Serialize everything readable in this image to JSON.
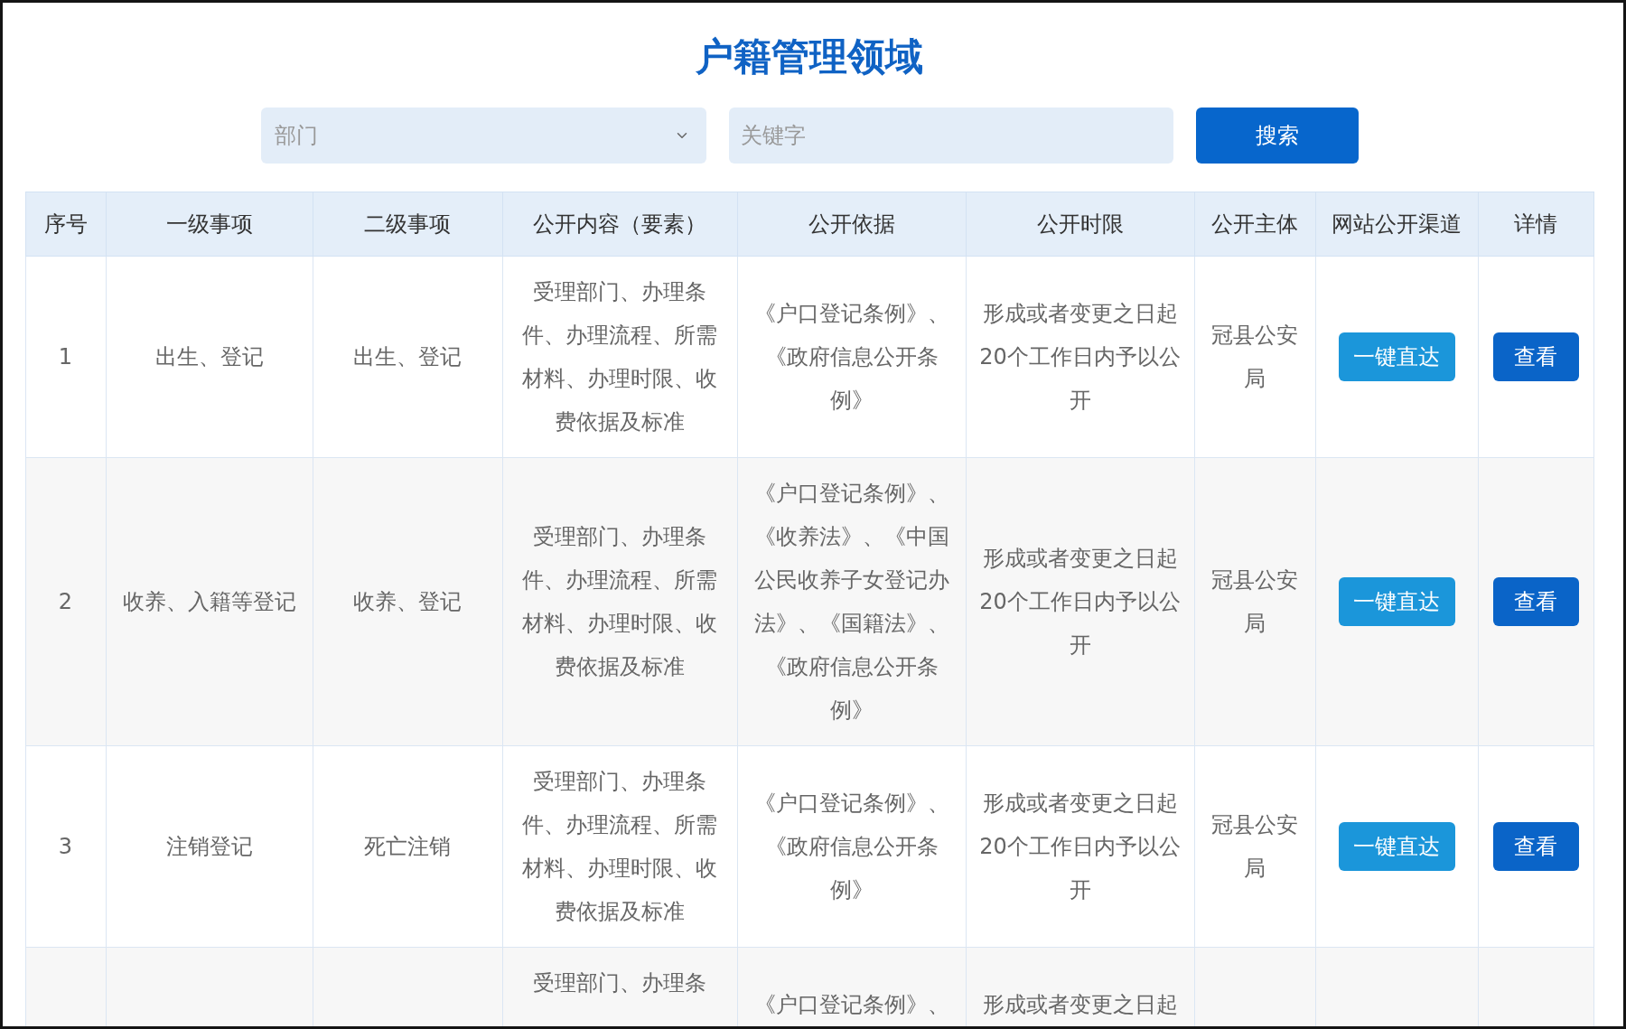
{
  "title": "户籍管理领域",
  "filters": {
    "department": {
      "placeholder": "部门"
    },
    "keyword": {
      "placeholder": "关键字"
    },
    "search_button": "搜索"
  },
  "table": {
    "columns": [
      "序号",
      "一级事项",
      "二级事项",
      "公开内容（要素）",
      "公开依据",
      "公开时限",
      "公开主体",
      "网站公开渠道",
      "详情"
    ],
    "rows": [
      {
        "index": "1",
        "item_level1": "出生、登记",
        "item_level2": "出生、登记",
        "content": "受理部门、办理条件、办理流程、所需材料、办理时限、收费依据及标准",
        "basis": "《户口登记条例》、《政府信息公开条例》",
        "time_limit": "形成或者变更之日起20个工作日内予以公开",
        "subject": "冠县公安局",
        "channel_button": "一键直达",
        "detail_button": "查看"
      },
      {
        "index": "2",
        "item_level1": "收养、入籍等登记",
        "item_level2": "收养、登记",
        "content": "受理部门、办理条件、办理流程、所需材料、办理时限、收费依据及标准",
        "basis": "《户口登记条例》、《收养法》、《中国公民收养子女登记办法》、《国籍法》、《政府信息公开条例》",
        "time_limit": "形成或者变更之日起20个工作日内予以公开",
        "subject": "冠县公安局",
        "channel_button": "一键直达",
        "detail_button": "查看"
      },
      {
        "index": "3",
        "item_level1": "注销登记",
        "item_level2": "死亡注销",
        "content": "受理部门、办理条件、办理流程、所需材料、办理时限、收费依据及标准",
        "basis": "《户口登记条例》、《政府信息公开条例》",
        "time_limit": "形成或者变更之日起20个工作日内予以公开",
        "subject": "冠县公安局",
        "channel_button": "一键直达",
        "detail_button": "查看"
      },
      {
        "content": "受理部门、办理条",
        "basis": "《户口登记条例》、",
        "time_limit": "形成或者变更之日起"
      }
    ]
  }
}
